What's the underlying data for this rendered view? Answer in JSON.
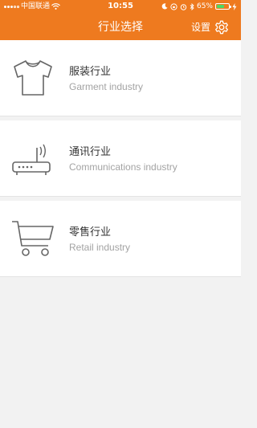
{
  "status_bar": {
    "carrier": "中国联通",
    "time": "10:55",
    "battery_percent": "65%",
    "battery_level": 0.65
  },
  "header": {
    "title": "行业选择",
    "settings_label": "设置"
  },
  "industries": [
    {
      "name_cn": "服装行业",
      "name_en": "Garment industry",
      "icon": "tshirt-icon"
    },
    {
      "name_cn": "通讯行业",
      "name_en": "Communications industry",
      "icon": "router-icon"
    },
    {
      "name_cn": "零售行业",
      "name_en": "Retail industry",
      "icon": "shopping-cart-icon"
    }
  ],
  "colors": {
    "accent": "#ee7a1f",
    "background": "#f2f2f2",
    "battery": "#4cd964"
  }
}
